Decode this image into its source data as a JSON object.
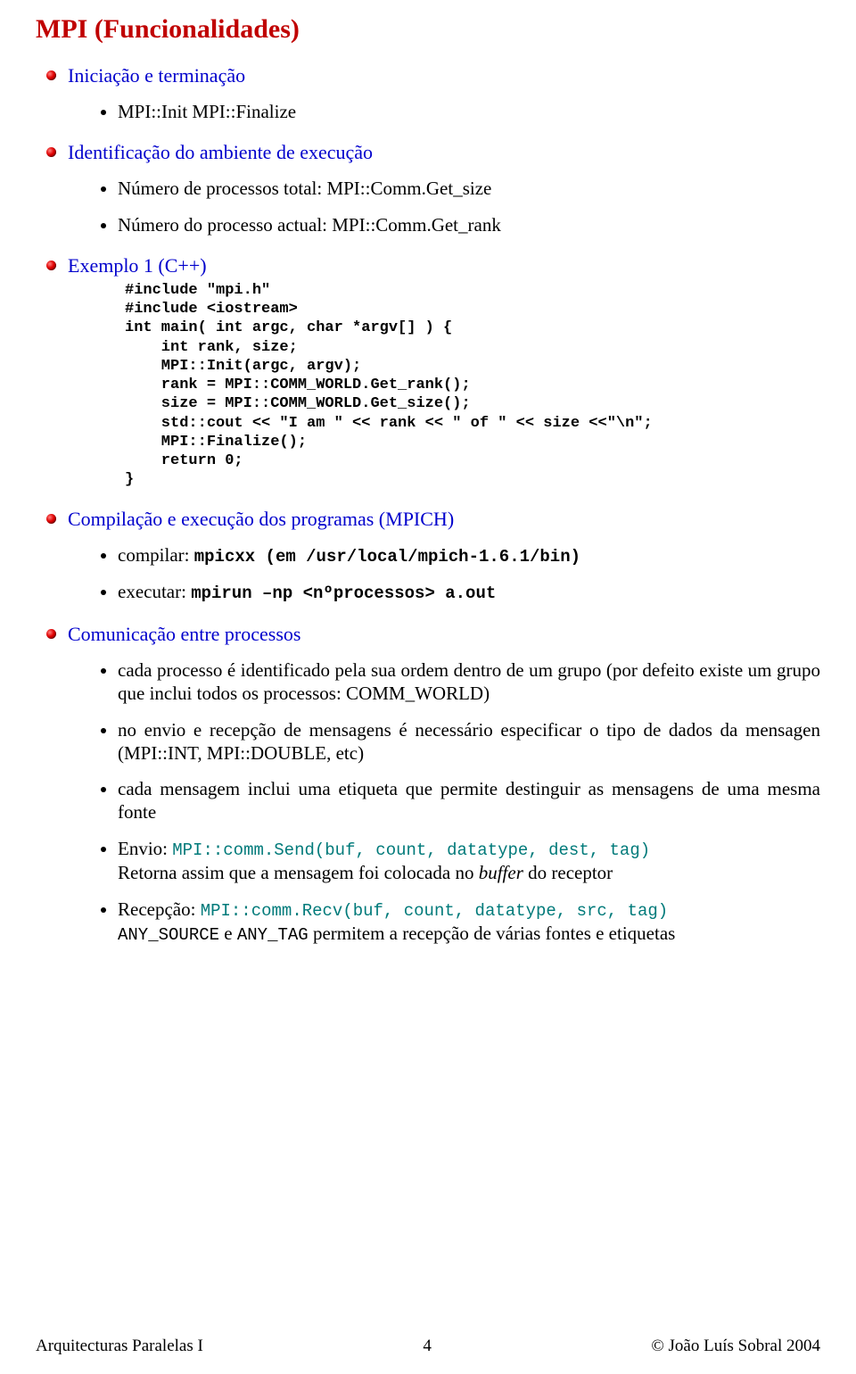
{
  "title": "MPI (Funcionalidades)",
  "sections": {
    "init": {
      "heading": "Iniciação e terminação",
      "items": [
        "MPI::Init MPI::Finalize"
      ]
    },
    "ident": {
      "heading": "Identificação do ambiente de execução",
      "items": [
        "Número de processos total: MPI::Comm.Get_size",
        "Número do processo actual: MPI::Comm.Get_rank"
      ]
    },
    "example": {
      "heading": "Exemplo 1 (C++)",
      "code": "#include \"mpi.h\"\n#include <iostream>\nint main( int argc, char *argv[] ) {\n    int rank, size;\n    MPI::Init(argc, argv);\n    rank = MPI::COMM_WORLD.Get_rank();\n    size = MPI::COMM_WORLD.Get_size();\n    std::cout << \"I am \" << rank << \" of \" << size <<\"\\n\";\n    MPI::Finalize();\n    return 0;\n}"
    },
    "compile": {
      "heading": "Compilação e execução dos programas (MPICH)",
      "item_compile_prefix": "compilar: ",
      "item_compile_cmd": "mpicxx    (em /usr/local/mpich-1.6.1/bin)",
      "item_exec_prefix": "executar: ",
      "item_exec_cmd": "mpirun –np <nºprocessos> a.out"
    },
    "comm": {
      "heading": "Comunicação entre processos",
      "p1": "cada processo é identificado pela sua ordem dentro de um grupo (por defeito existe um grupo que inclui todos os processos: COMM_WORLD)",
      "p2": "no envio e recepção de mensagens é necessário especificar o tipo de dados da mensagen (MPI::INT, MPI::DOUBLE, etc)",
      "p3": "cada mensagem inclui uma etiqueta que permite destinguir as mensagens de uma mesma fonte",
      "envio_label": "Envio: ",
      "envio_api": "MPI::comm.Send(buf, count, datatype, dest, tag)",
      "envio_desc_a": "Retorna assim que a mensagem foi colocada no ",
      "envio_desc_b": "buffer",
      "envio_desc_c": " do receptor",
      "recv_label": "Recepção: ",
      "recv_api": "MPI::comm.Recv(buf, count, datatype, src, tag)",
      "recv_tags": "ANY_SOURCE",
      "recv_mid": " e ",
      "recv_tags2": "ANY_TAG",
      "recv_desc": " permitem a recepção de várias fontes e etiquetas"
    }
  },
  "footer": {
    "left": "Arquitecturas Paralelas I",
    "center": "4",
    "right": "© João Luís Sobral 2004"
  }
}
